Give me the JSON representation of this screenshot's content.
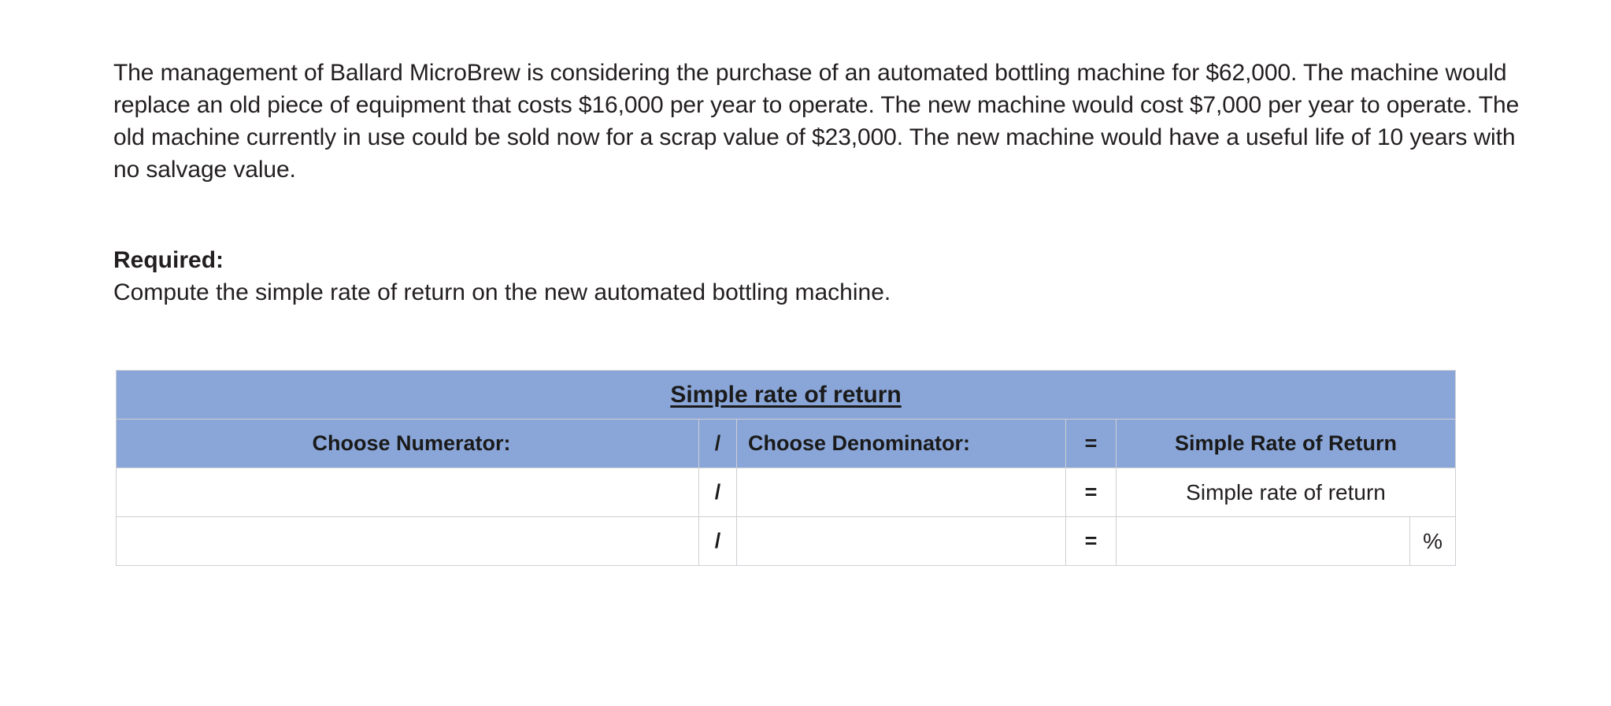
{
  "problem": {
    "statement": "The management of Ballard MicroBrew is considering the purchase of an automated bottling machine for $62,000. The machine would replace an old piece of equipment that costs $16,000 per year to operate. The new machine would cost $7,000 per year to operate. The old machine currently in use could be sold now for a scrap value of $23,000. The new machine would have a useful life of 10 years with no salvage value.",
    "required_label": "Required:",
    "required_text": "Compute the simple rate of return on the new automated bottling machine."
  },
  "table": {
    "title": "Simple rate of return",
    "headers": {
      "numerator": "Choose Numerator:",
      "divide": "/",
      "denominator": "Choose Denominator:",
      "equals": "=",
      "result": "Simple Rate of Return"
    },
    "rows": [
      {
        "numerator_value": "",
        "numerator_placeholder": "",
        "divide": "/",
        "denominator_value": "",
        "denominator_placeholder": "",
        "equals": "=",
        "result": "Simple rate of return",
        "percent": ""
      },
      {
        "numerator_value": "",
        "numerator_placeholder": "",
        "divide": "/",
        "denominator_value": "",
        "denominator_placeholder": "",
        "equals": "=",
        "result": "",
        "percent": "%"
      }
    ]
  },
  "colors": {
    "header_blue": "#8aa6d8",
    "entry_outline_yellow": "#ffe800",
    "grid_gray": "#cfcfd4",
    "text": "#231f20"
  }
}
